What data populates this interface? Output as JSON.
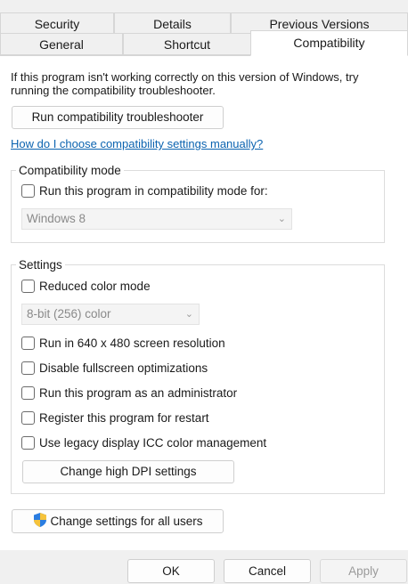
{
  "tabs": {
    "row1": [
      "Security",
      "Details",
      "Previous Versions"
    ],
    "row2": [
      "General",
      "Shortcut",
      "Compatibility"
    ],
    "active": "Compatibility"
  },
  "intro_text": "If this program isn't working correctly on this version of Windows, try running the compatibility troubleshooter.",
  "run_troubleshooter_label": "Run compatibility troubleshooter",
  "manual_link": "How do I choose compatibility settings manually?",
  "compat_mode": {
    "legend": "Compatibility mode",
    "checkbox_label": "Run this program in compatibility mode for:",
    "checked": false,
    "os_selected": "Windows 8"
  },
  "settings": {
    "legend": "Settings",
    "reduced_color_label": "Reduced color mode",
    "color_selected": "8-bit (256) color",
    "options": [
      {
        "label": "Run in 640 x 480 screen resolution",
        "checked": false
      },
      {
        "label": "Disable fullscreen optimizations",
        "checked": false
      },
      {
        "label": "Run this program as an administrator",
        "checked": false
      },
      {
        "label": "Register this program for restart",
        "checked": false
      },
      {
        "label": "Use legacy display ICC color management",
        "checked": false
      }
    ],
    "dpi_button_label": "Change high DPI settings"
  },
  "all_users_button_label": "Change settings for all users",
  "footer": {
    "ok_label": "OK",
    "cancel_label": "Cancel",
    "apply_label": "Apply"
  },
  "colors": {
    "link": "#0b63b0",
    "panel_bg": "#ffffff",
    "window_bg": "#f0f0f0"
  }
}
